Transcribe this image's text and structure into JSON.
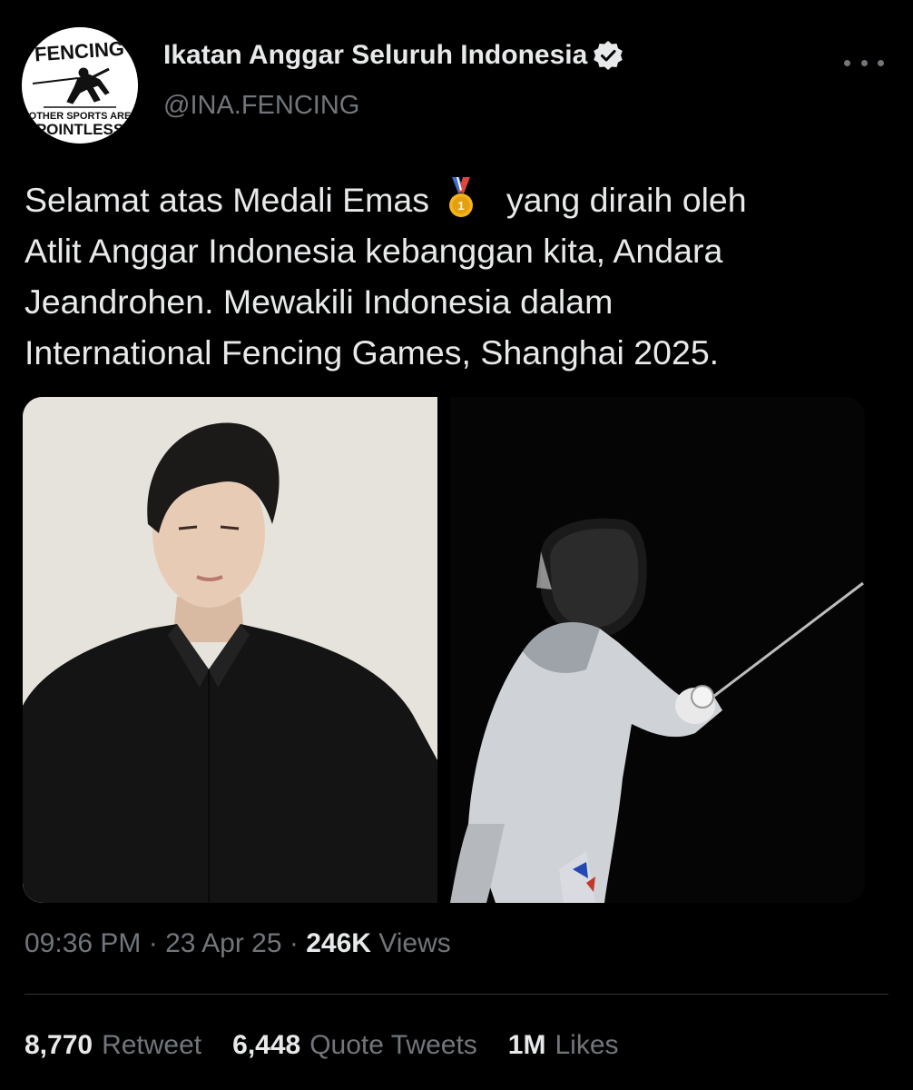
{
  "author": {
    "display_name": "Ikatan Anggar Seluruh Indonesia",
    "handle": "@INA.FENCING",
    "verified": true,
    "avatar": {
      "top_text": "FENCING",
      "bottom_text_1": "OTHER SPORTS ARE",
      "bottom_text_2": "POINTLESS"
    }
  },
  "tweet": {
    "lines": [
      "Selamat atas Medali Emas",
      "yang diraih oleh",
      "Atlit Anggar Indonesia kebanggan kita, Andara",
      "Jeandrohen. Mewakili Indonesia dalam",
      "International Fencing Games, Shanghai 2025."
    ],
    "emoji": "first-place-medal-icon"
  },
  "meta": {
    "time": "09:36 PM",
    "sep1": "·",
    "date": "23 Apr 25",
    "sep2": "·",
    "views_count": "246K",
    "views_label": "Views"
  },
  "stats": {
    "retweets_count": "8,770",
    "retweets_label": "Retweet",
    "quotes_count": "6,448",
    "quotes_label": "Quote Tweets",
    "likes_count": "1M",
    "likes_label": "Likes"
  },
  "colors": {
    "background": "#000000",
    "text_primary": "#e7e9ea",
    "text_secondary": "#71767b",
    "divider": "#2f3336",
    "medal_gold": "#f5b31c",
    "medal_ribbon": "#3b6fd1"
  }
}
